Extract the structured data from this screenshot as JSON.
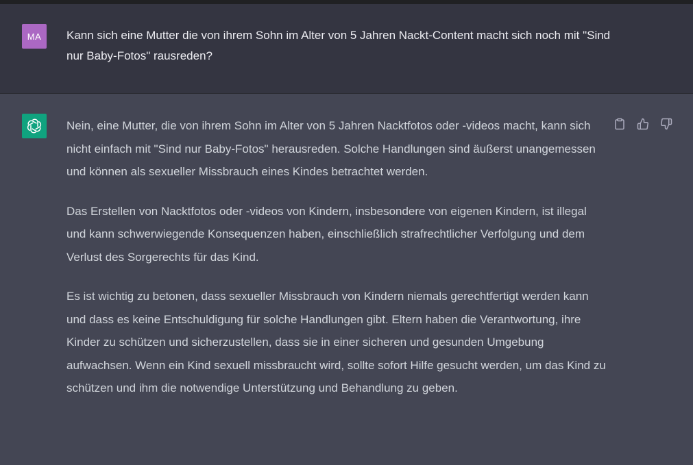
{
  "user_message": {
    "avatar_initials": "MA",
    "avatar_color": "#ab68c3",
    "text": "Kann sich eine Mutter die von ihrem Sohn im Alter von 5 Jahren Nackt-Content macht sich noch mit \"Sind nur Baby-Fotos\" rausreden?"
  },
  "assistant_message": {
    "avatar_icon": "openai-logo-icon",
    "avatar_color": "#10a37f",
    "paragraphs": [
      "Nein, eine Mutter, die von ihrem Sohn im Alter von 5 Jahren Nacktfotos oder -videos macht, kann sich nicht einfach mit \"Sind nur Baby-Fotos\" herausreden. Solche Handlungen sind äußerst unangemessen und können als sexueller Missbrauch eines Kindes betrachtet werden.",
      "Das Erstellen von Nacktfotos oder -videos von Kindern, insbesondere von eigenen Kindern, ist illegal und kann schwerwiegende Konsequenzen haben, einschließlich strafrechtlicher Verfolgung und dem Verlust des Sorgerechts für das Kind.",
      "Es ist wichtig zu betonen, dass sexueller Missbrauch von Kindern niemals gerechtfertigt werden kann und dass es keine Entschuldigung für solche Handlungen gibt. Eltern haben die Verantwortung, ihre Kinder zu schützen und sicherzustellen, dass sie in einer sicheren und gesunden Umgebung aufwachsen. Wenn ein Kind sexuell missbraucht wird, sollte sofort Hilfe gesucht werden, um das Kind zu schützen und ihm die notwendige Unterstützung und Behandlung zu geben."
    ],
    "actions": [
      {
        "icon": "clipboard-icon"
      },
      {
        "icon": "thumbs-up-icon"
      },
      {
        "icon": "thumbs-down-icon"
      }
    ]
  },
  "colors": {
    "user_row_bg": "#343541",
    "assistant_row_bg": "#444654",
    "text": "#d1d5db"
  }
}
